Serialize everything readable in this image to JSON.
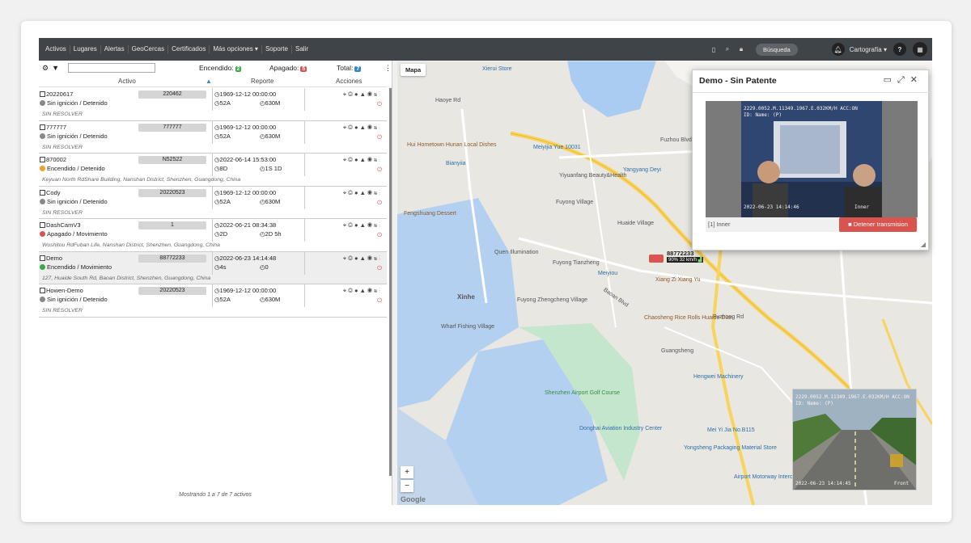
{
  "nav": [
    "Activos",
    "Lugares",
    "Alertas",
    "GeoCercas",
    "Certificados",
    "Más opciones ▾",
    "Soporte",
    "Salir"
  ],
  "topbar": {
    "search": "Búsqueda",
    "cartography": "Cartografía ▾",
    "help": "?"
  },
  "filters": {
    "on_label": "Encendido:",
    "on_count": "2",
    "off_label": "Apagado:",
    "off_count": "5",
    "total_label": "Total:",
    "total_count": "7"
  },
  "headers": {
    "asset": "Activo",
    "report": "Reporte",
    "actions": "Acciones"
  },
  "rows": [
    {
      "name": "20220617",
      "id": "220462",
      "status": "Sin ignición / Detenido",
      "status_color": "#888",
      "date": "1969-12-12 00:00:00",
      "v1": "52A",
      "v2": "630M",
      "addr": "SIN RESOLVER"
    },
    {
      "name": "777777",
      "id": "777777",
      "status": "Sin ignición / Detenido",
      "status_color": "#888",
      "date": "1969-12-12 00:00:00",
      "v1": "52A",
      "v2": "630M",
      "addr": "SIN RESOLVER"
    },
    {
      "name": "870002",
      "id": "N52522",
      "status": "Encendido / Detenido",
      "status_color": "#f0a030",
      "date": "2022-06-14 15:53:00",
      "v1": "8D",
      "v2": "1S 1D",
      "addr": "Keyuan North RdShare Building, Nanshan District, Shenzhen, Guangdong, China"
    },
    {
      "name": "Cody",
      "id": "20220523",
      "status": "Sin ignición / Detenido",
      "status_color": "#888",
      "date": "1969-12-12 00:00:00",
      "v1": "52A",
      "v2": "630M",
      "addr": "SIN RESOLVER"
    },
    {
      "name": "DashCamV3",
      "id": "1",
      "status": "Apagado / Movimiento",
      "status_color": "#d9534f",
      "date": "2022-06-21 08:34:38",
      "v1": "2D",
      "v2": "2D 5h",
      "addr": "Wushitou RdFuban Life, Nanshan District, Shenzhen, Guangdong, China"
    },
    {
      "name": "Demo",
      "id": "88772233",
      "status": "Encendido / Movimiento",
      "status_color": "#3aa84a",
      "date": "2022-06-23 14:14:48",
      "v1": "4s",
      "v2": "0",
      "addr": "127, Huaide South Rd, Baoan District, Shenzhen, Guangdong, China"
    },
    {
      "name": "Howen-Demo",
      "id": "20220523",
      "status": "Sin ignición / Detenido",
      "status_color": "#888",
      "date": "1969-12-12 00:00:00",
      "v1": "52A",
      "v2": "630M",
      "addr": "SIN RESOLVER"
    }
  ],
  "footer": "Mostrando 1 a 7 de 7 activos",
  "map": {
    "type": "Mapa",
    "vehicle_id": "88772233",
    "battery": "90%",
    "speed": "32 km/h",
    "labels": [
      "Xierui Store",
      "Haoye Rd",
      "Hui Hometown Hunan Local Dishes",
      "Meiyijia Yue 10031",
      "Bianyiia",
      "Yiyuanfang Beauty&Health",
      "Yangyang Deyi",
      "Fuyong Village",
      "Fuzhou Blvd",
      "Huaide Village",
      "Fengshuang Dessert",
      "Fuyong Tianzheng",
      "Quen Illumination",
      "Meiyiou",
      "Xiang Zi Xiang Yu",
      "Chaosheng Rice Rolls Huaide Dian",
      "Fuzhong Rd",
      "Xinhe",
      "Fuyong Zhengcheng Village",
      "Wharf Fishing Village",
      "Guangsheng",
      "Baoan Blvd",
      "Shenzhen Airport Golf Course",
      "Donghai Aviation Industry Center",
      "Hengwei Machinery",
      "Mei Yi Jia No.B115",
      "Yongsheng Packaging Material Store",
      "Airport Motorway Interchange"
    ],
    "google": "Google"
  },
  "popup": {
    "title": "Demo - Sin Patente",
    "camera": "[1] Inner",
    "stop": "Detener transmision",
    "osd_top": "2229.0052.M.11349.1967.E.032KM/H ACC:ON",
    "osd_id": "ID: Name: (P)",
    "osd_time": "2022-06-23 14:14:46",
    "osd_cam": "Inner"
  },
  "pip": {
    "osd_top": "2229.0052.M.11349.1967.E.032KM/H ACC:ON",
    "osd_id": "ID: Name: (P)",
    "osd_time": "2022-06-23 14:14:45",
    "osd_cam": "Front"
  }
}
